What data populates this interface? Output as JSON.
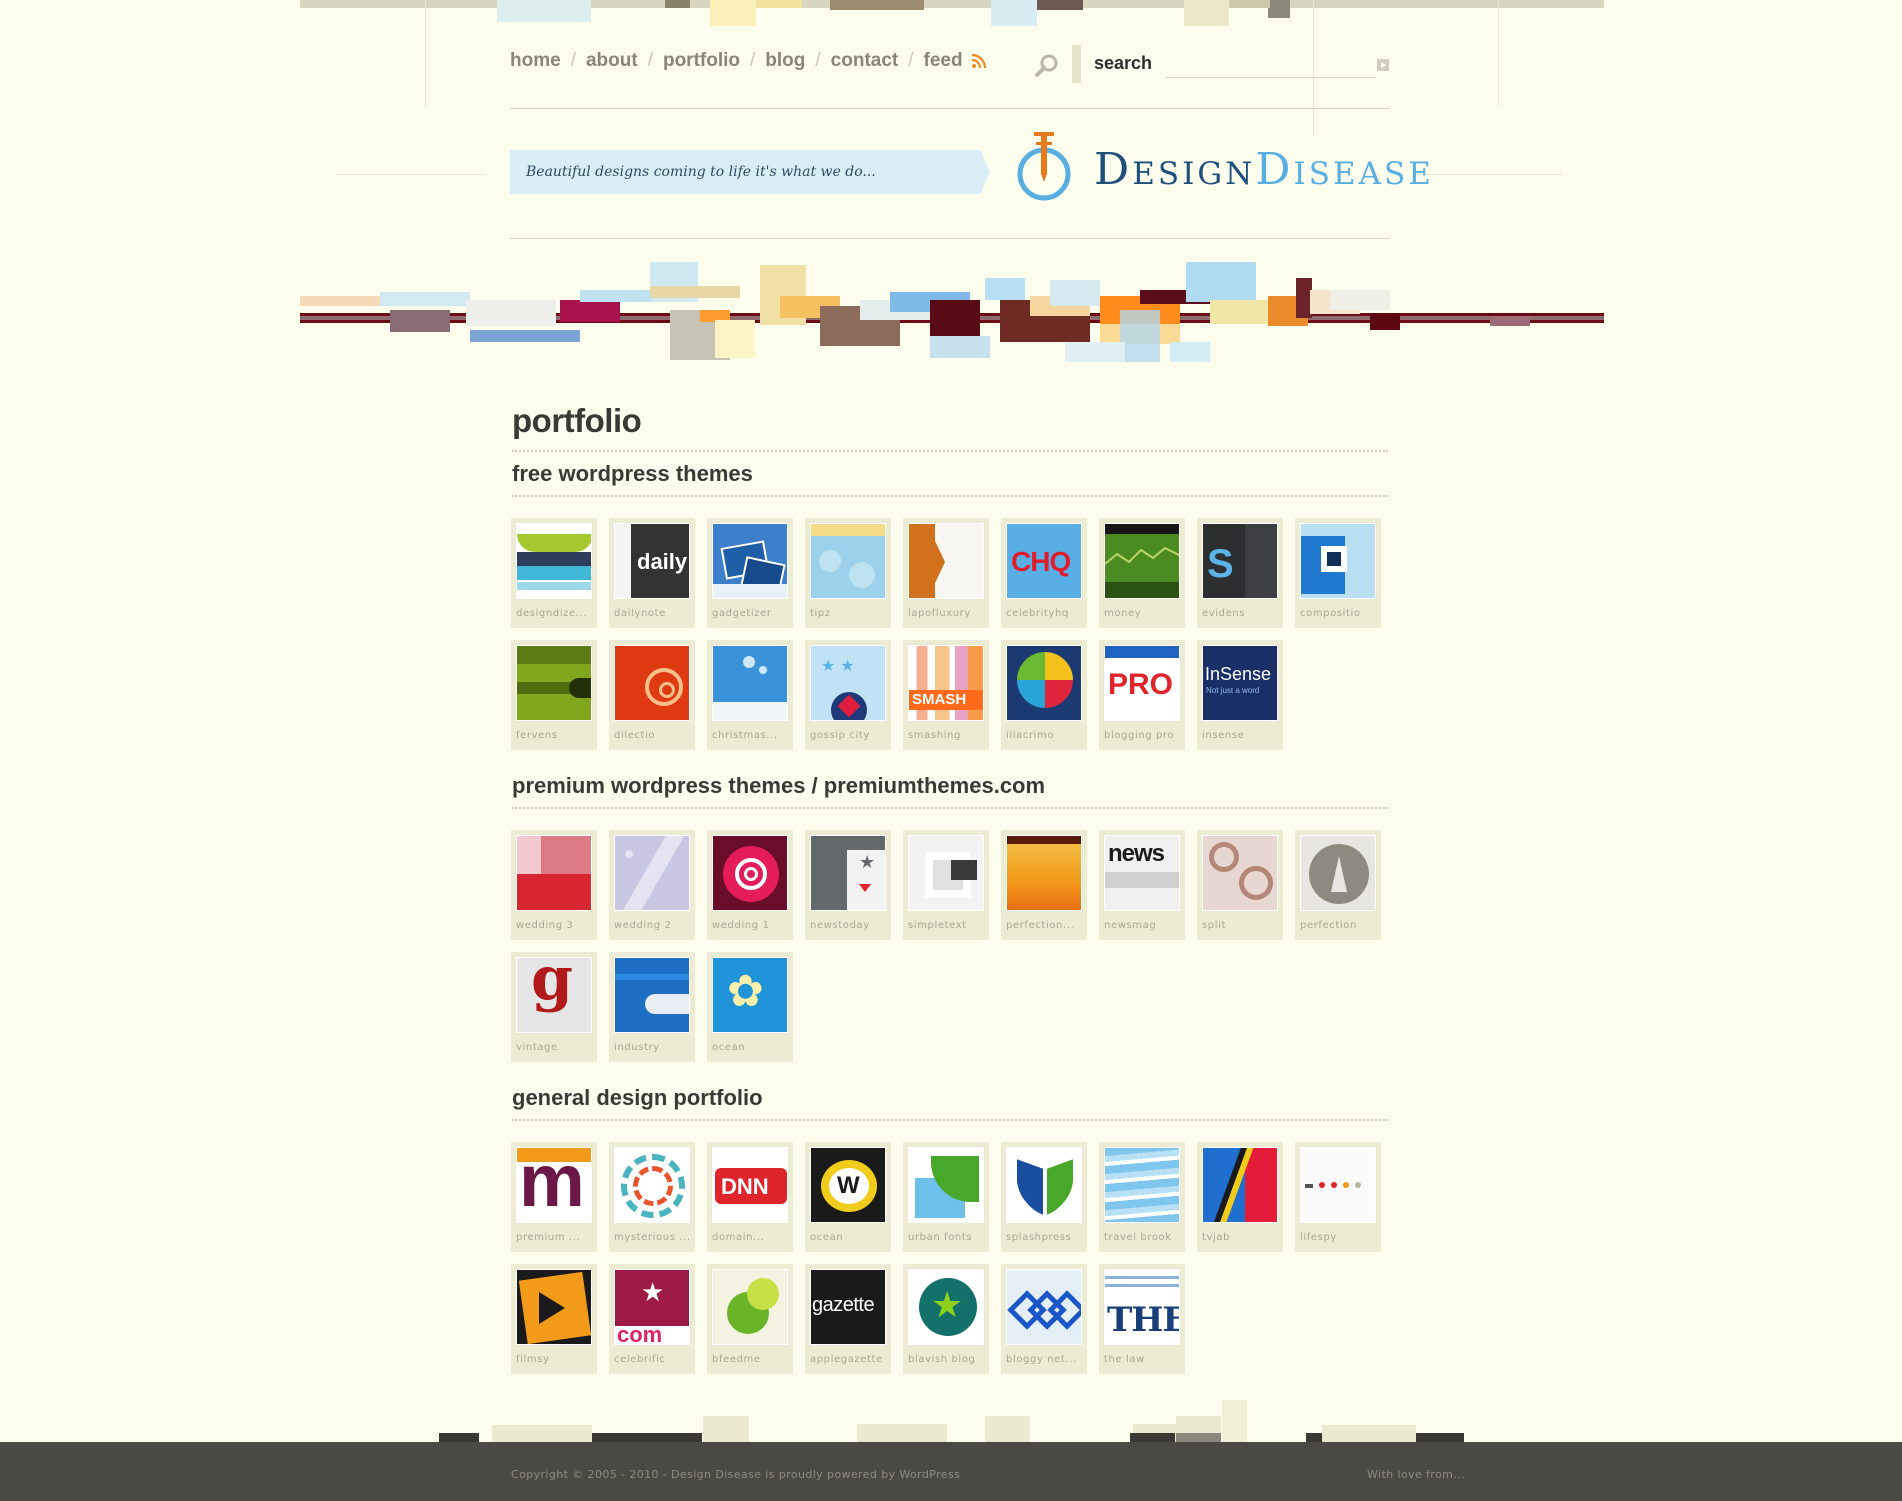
{
  "nav": {
    "items": [
      "home",
      "about",
      "portfolio",
      "blog",
      "contact",
      "feed"
    ],
    "separator": "/"
  },
  "search": {
    "label": "search",
    "value": ""
  },
  "header": {
    "tagline": "Beautiful designs coming to life it's what we do...",
    "logo_part1": "Design",
    "logo_part2": "Disease"
  },
  "page": {
    "title": "portfolio"
  },
  "sections": {
    "free": {
      "title": "free wordpress themes",
      "items": [
        "designdize...",
        "dailynote",
        "gadgetizer",
        "tipz",
        "lapofluxury",
        "celebrityhq",
        "money",
        "evidens",
        "compositio",
        "fervens",
        "dilectio",
        "christmas...",
        "gossip city",
        "smashing",
        "illacrimo",
        "blogging pro",
        "insense"
      ]
    },
    "premium": {
      "title": "premium wordpress themes / premiumthemes.com",
      "items": [
        "wedding 3",
        "wedding 2",
        "wedding 1",
        "newstoday",
        "simpletext",
        "perfection...",
        "newsmag",
        "split",
        "perfection",
        "vintage",
        "industry",
        "ocean"
      ]
    },
    "general": {
      "title": "general design portfolio",
      "items": [
        "premium ...",
        "mysterious ...",
        "domain...",
        "ocean",
        "urban fonts",
        "splashpress",
        "travel brook",
        "tvjab",
        "lifespy",
        "filmsy",
        "celebrific",
        "bfeedme",
        "applegazette",
        "blavish blog",
        "bloggy net...",
        "the law"
      ]
    }
  },
  "thumb_text": {
    "daily": "daily",
    "chq": "CHQ",
    "s": "S",
    "smash": "SMASH",
    "pro": "PRO",
    "insense": "InSense",
    "insense_sub": "Not just a word",
    "news": "news",
    "g": "g",
    "m": "m",
    "dnn": "DNN",
    "w": "W",
    "gazette": "gazette",
    "the": "THE",
    "com": "com"
  },
  "footer": {
    "copyright": "Copyright © 2005 - 2010 - Design Disease is proudly powered by WordPress",
    "right": "With love from..."
  },
  "colors": {
    "background": "#fdfdee",
    "footer": "#4a4943",
    "accent_orange": "#e87a1e",
    "logo_blue": "#58aee0",
    "rss": "#f08a24"
  }
}
